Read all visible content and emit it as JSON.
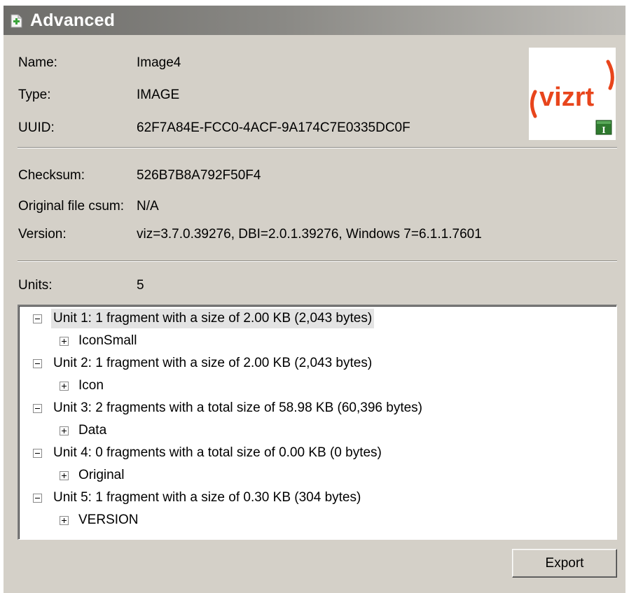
{
  "window": {
    "title": "Advanced"
  },
  "details": {
    "name_label": "Name:",
    "name_value": "Image4",
    "type_label": "Type:",
    "type_value": "IMAGE",
    "uuid_label": "UUID:",
    "uuid_value": "62F7A84E-FCC0-4ACF-9A174C7E0335DC0F",
    "checksum_label": "Checksum:",
    "checksum_value": "526B7B8A792F50F4",
    "original_label": "Original file csum:",
    "original_value": "N/A",
    "version_label": "Version:",
    "version_value": "viz=3.7.0.39276, DBI=2.0.1.39276, Windows 7=6.1.1.7601",
    "units_label": "Units:",
    "units_value": "5"
  },
  "logo": {
    "text": "vizrt",
    "color": "#e8451c",
    "badge_text": "I"
  },
  "tree": {
    "units": [
      {
        "label": "Unit 1: 1 fragment with a size of 2.00 KB (2,043 bytes)",
        "child": "IconSmall",
        "selected": true
      },
      {
        "label": "Unit 2: 1 fragment with a size of 2.00 KB (2,043 bytes)",
        "child": "Icon",
        "selected": false
      },
      {
        "label": "Unit 3: 2 fragments with a total size of 58.98 KB (60,396 bytes)",
        "child": "Data",
        "selected": false
      },
      {
        "label": "Unit 4: 0 fragments with a total size of 0.00 KB (0 bytes)",
        "child": "Original",
        "selected": false
      },
      {
        "label": "Unit 5: 1 fragment with a size of 0.30 KB (304 bytes)",
        "child": "VERSION",
        "selected": false
      }
    ]
  },
  "buttons": {
    "export_label": "Export"
  }
}
